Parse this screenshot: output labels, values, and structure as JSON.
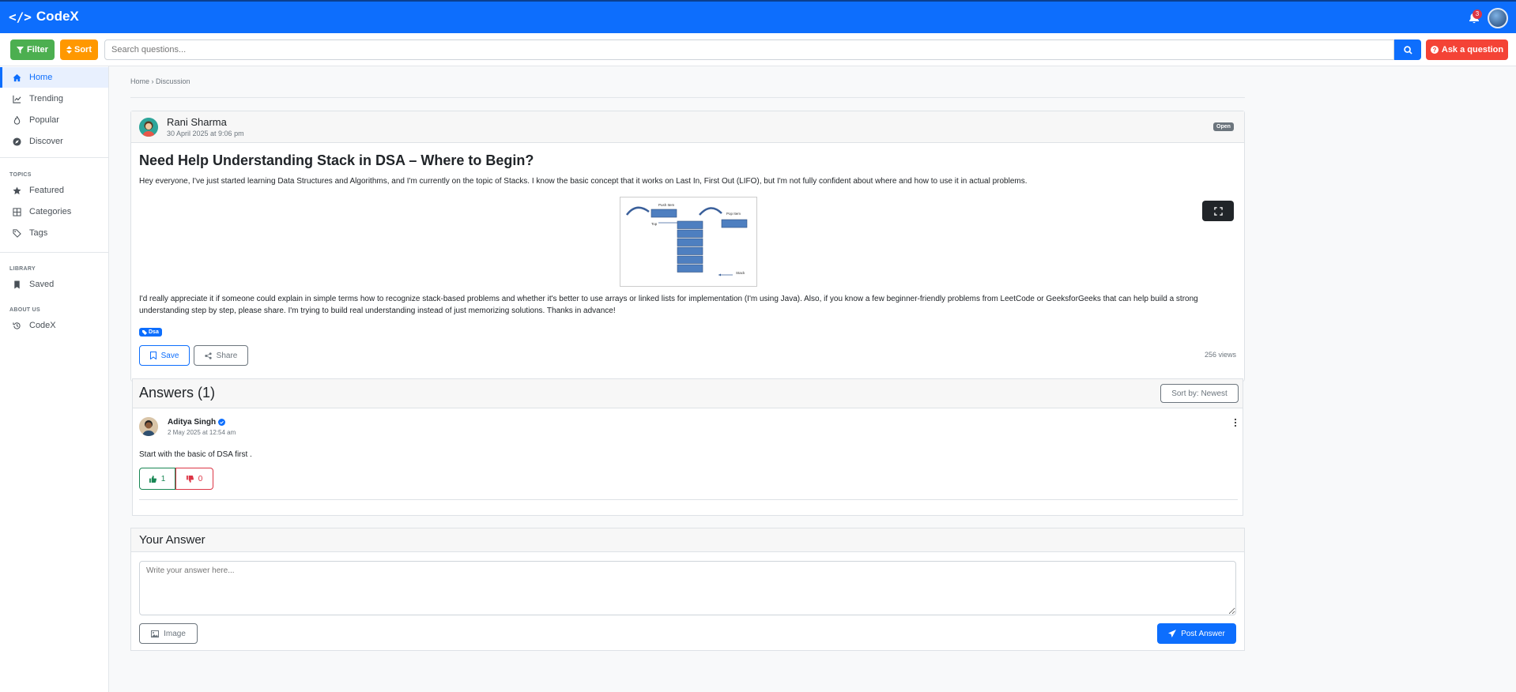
{
  "app": {
    "brand": "CodeX",
    "notification_count": "3"
  },
  "toolbar": {
    "filter_label": "Filter",
    "sort_label": "Sort",
    "search_placeholder": "Search questions...",
    "ask_label": "Ask a question"
  },
  "sidebar": {
    "main_items": [
      {
        "label": "Home",
        "icon": "home-icon",
        "active": true
      },
      {
        "label": "Trending",
        "icon": "trending-icon"
      },
      {
        "label": "Popular",
        "icon": "fire-icon"
      },
      {
        "label": "Discover",
        "icon": "compass-icon"
      }
    ],
    "topics_heading": "TOPICS",
    "topic_items": [
      {
        "label": "Featured",
        "icon": "star-icon"
      },
      {
        "label": "Categories",
        "icon": "grid-icon"
      },
      {
        "label": "Tags",
        "icon": "tags-icon"
      }
    ],
    "library_heading": "LIBRARY",
    "library_items": [
      {
        "label": "Saved",
        "icon": "bookmark-icon"
      }
    ],
    "about_heading": "ABOUT US",
    "about_items": [
      {
        "label": "CodeX",
        "icon": "history-icon"
      }
    ]
  },
  "breadcrumb": "Home › Discussion",
  "post": {
    "author": "Rani Sharma",
    "date": "30 April 2025 at 9:06 pm",
    "status": "Open",
    "title": "Need Help Understanding Stack in DSA – Where to Begin?",
    "body_1": "Hey everyone, I've just started learning Data Structures and Algorithms, and I'm currently on the topic of Stacks. I know the basic concept that it works on Last In, First Out (LIFO), but I'm not fully confident about where and how to use it in actual problems.",
    "body_2": "I'd really appreciate it if someone could explain in simple terms how to recognize stack-based problems and whether it's better to use arrays or linked lists for implementation (I'm using Java). Also, if you know a few beginner-friendly problems from LeetCode or GeeksforGeeks that can help build a strong understanding step by step, please share. I'm trying to build real understanding instead of just memorizing solutions. Thanks in advance!",
    "diagram_labels": {
      "push": "Push Item",
      "pop": "Pop Item",
      "top": "Top",
      "stack": "Stack"
    },
    "tag": "Dsa",
    "save_label": "Save",
    "share_label": "Share",
    "views": "256 views"
  },
  "answers": {
    "title": "Answers (1)",
    "sort_label": "Sort by: Newest",
    "items": [
      {
        "author": "Aditya Singh",
        "date": "2 May 2025 at 12:54 am",
        "text": "Start with the basic of DSA first .",
        "upvotes": "1",
        "downvotes": "0"
      }
    ]
  },
  "your_answer": {
    "title": "Your Answer",
    "placeholder": "Write your answer here...",
    "image_label": "Image",
    "post_label": "Post Answer"
  },
  "colors": {
    "primary": "#0d6efd",
    "filter": "#4caf50",
    "sort": "#ff9800",
    "ask": "#f44336"
  }
}
